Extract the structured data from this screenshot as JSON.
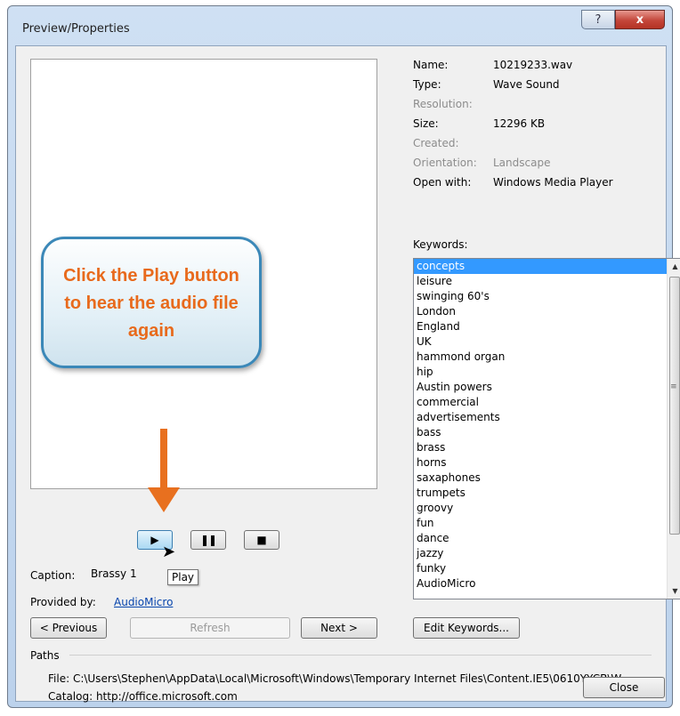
{
  "window": {
    "title": "Preview/Properties",
    "help_label": "?",
    "close_label": "x"
  },
  "callout": {
    "text": "Click the Play button to hear the audio file again"
  },
  "player": {
    "play_icon": "play-icon",
    "pause_icon": "pause-icon",
    "stop_icon": "stop-icon",
    "tooltip": "Play"
  },
  "caption": {
    "label": "Caption:",
    "value": "Brassy 1"
  },
  "provider": {
    "label": "Provided by:",
    "value": "AudioMicro"
  },
  "nav": {
    "previous": "< Previous",
    "refresh": "Refresh",
    "next": "Next >"
  },
  "properties": [
    {
      "key": "Name:",
      "value": "10219233.wav",
      "dim": false
    },
    {
      "key": "Type:",
      "value": "Wave Sound",
      "dim": false
    },
    {
      "key": "Resolution:",
      "value": "",
      "dim": true
    },
    {
      "key": "Size:",
      "value": "12296 KB",
      "dim": false
    },
    {
      "key": "Created:",
      "value": "",
      "dim": true
    },
    {
      "key": "Orientation:",
      "value": "Landscape",
      "dim": true
    },
    {
      "key": "Open with:",
      "value": "Windows Media Player",
      "dim": false
    }
  ],
  "keywords": {
    "label": "Keywords:",
    "selected_index": 0,
    "items": [
      "concepts",
      "leisure",
      "swinging 60's",
      "London",
      "England",
      "UK",
      "hammond organ",
      "hip",
      "Austin powers",
      "commercial",
      "advertisements",
      "bass",
      "brass",
      "horns",
      "saxaphones",
      "trumpets",
      "groovy",
      "fun",
      "dance",
      "jazzy",
      "funky",
      "AudioMicro"
    ],
    "edit_button": "Edit Keywords..."
  },
  "paths": {
    "label": "Paths",
    "file": "File: C:\\Users\\Stephen\\AppData\\Local\\Microsoft\\Windows\\Temporary Internet Files\\Content.IE5\\0610YYCB\\W",
    "catalog": "Catalog: http://office.microsoft.com"
  },
  "close_button": "Close",
  "colors": {
    "accent_orange": "#e8701f",
    "callout_border": "#3b88b8",
    "selection": "#3399ff"
  }
}
